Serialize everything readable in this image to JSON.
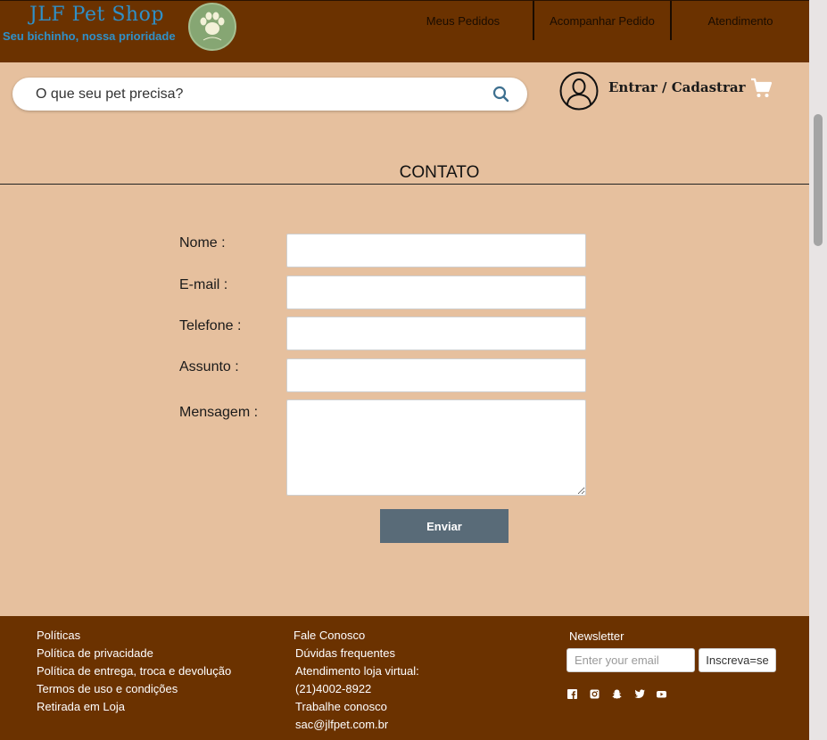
{
  "header": {
    "brand_title": "JLF Pet Shop",
    "brand_tagline": "Seu bichinho, nossa prioridade",
    "nav": [
      "Meus Pedidos",
      "Acompanhar Pedido",
      "Atendimento"
    ]
  },
  "search": {
    "placeholder": "O que seu pet precisa?"
  },
  "account": {
    "label": "Entrar / Cadastrar"
  },
  "contact": {
    "heading": "CONTATO",
    "labels": {
      "name": "Nome :",
      "email": "E-mail :",
      "phone": "Telefone :",
      "subject": "Assunto :",
      "message": "Mensagem :"
    },
    "submit_label": "Enviar"
  },
  "footer": {
    "col1": [
      "Políticas",
      "Política de privacidade",
      "Política de entrega, troca e devolução",
      "Termos de uso e condições",
      "Retirada em Loja"
    ],
    "col2": [
      "Fale Conosco",
      "Dúvidas frequentes",
      "Atendimento loja virtual:",
      "(21)4002-8922",
      "Trabalhe conosco",
      "sac@jlfpet.com.br"
    ],
    "newsletter": {
      "title": "Newsletter",
      "placeholder": "Enter your email",
      "button": "Inscreva=se"
    },
    "social_icons": [
      "facebook-icon",
      "instagram-icon",
      "snapchat-icon",
      "twitter-icon",
      "youtube-icon"
    ]
  },
  "colors": {
    "header_bg": "#6b3200",
    "page_bg": "#e6c09e",
    "brand_blue": "#2f90c8",
    "submit_bg": "#596b78",
    "search_icon": "#3d6f8f"
  }
}
